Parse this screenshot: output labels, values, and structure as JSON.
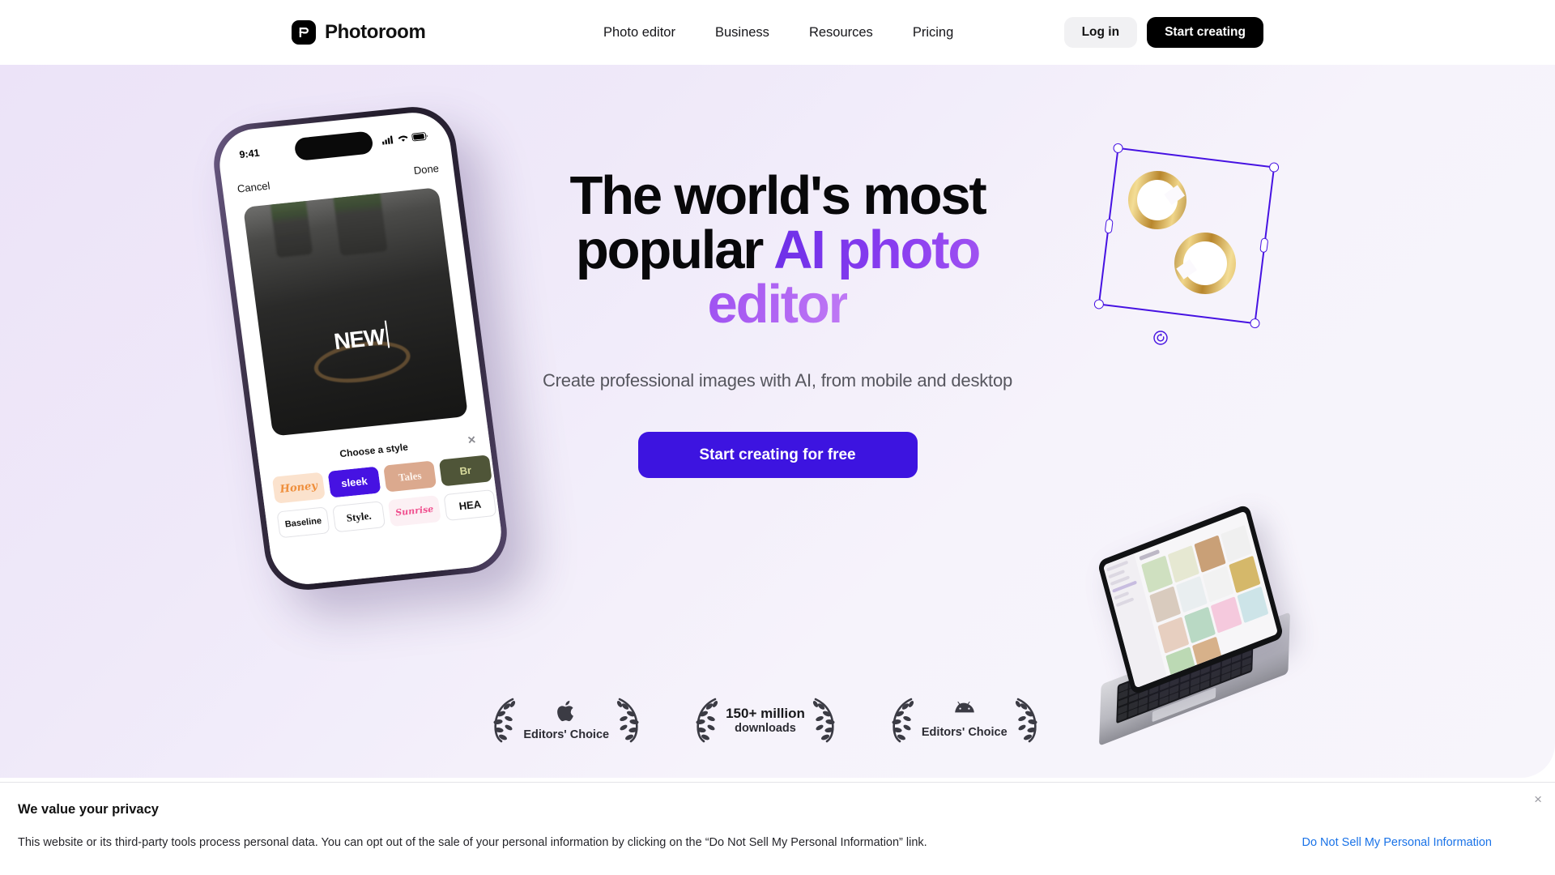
{
  "header": {
    "logo_text": "Photoroom",
    "logo_icon": "photoroom-logo-mark",
    "nav": [
      {
        "label": "Photo editor"
      },
      {
        "label": "Business"
      },
      {
        "label": "Resources"
      },
      {
        "label": "Pricing"
      }
    ],
    "login_label": "Log in",
    "start_label": "Start creating"
  },
  "hero": {
    "headline_part1": "The world's most popular ",
    "headline_accent": "AI photo editor",
    "subtitle": "Create professional images with AI, from mobile and desktop",
    "cta_label": "Start creating for free",
    "accent_color": "#8b3ef0",
    "cta_color": "#3d14e0",
    "background_color": "#efe9f9"
  },
  "awards": [
    {
      "icon": "apple-icon",
      "label": "Editors' Choice",
      "big": "",
      "sub": ""
    },
    {
      "icon": "",
      "label": "",
      "big": "150+ million",
      "sub": "downloads"
    },
    {
      "icon": "android-icon",
      "label": "Editors' Choice",
      "big": "",
      "sub": ""
    }
  ],
  "phone": {
    "time": "9:41",
    "cancel_label": "Cancel",
    "done_label": "Done",
    "canvas_text": "NEW",
    "style_panel_title": "Choose a style",
    "close_icon": "close-icon",
    "styles_row1": [
      {
        "label": "Honey"
      },
      {
        "label": "sleek"
      },
      {
        "label": "Tales"
      },
      {
        "label": "Br"
      }
    ],
    "styles_row2": [
      {
        "label": "Baseline"
      },
      {
        "label": "Style."
      },
      {
        "label": "Sunrise"
      },
      {
        "label": "HEA"
      }
    ]
  },
  "canvas_selection": {
    "rotate_icon": "rotate-icon",
    "subject": "gold-hoop-earrings",
    "selection_color": "#4612e2"
  },
  "cookie_banner": {
    "title": "We value your privacy",
    "text": "This website or its third-party tools process personal data. You can opt out of the sale of your personal information by clicking on the “Do Not Sell My Personal Information” link.",
    "link_label": "Do Not Sell My Personal Information",
    "link_color": "#1a73e8",
    "close_icon": "close-icon",
    "close_label": "×"
  }
}
